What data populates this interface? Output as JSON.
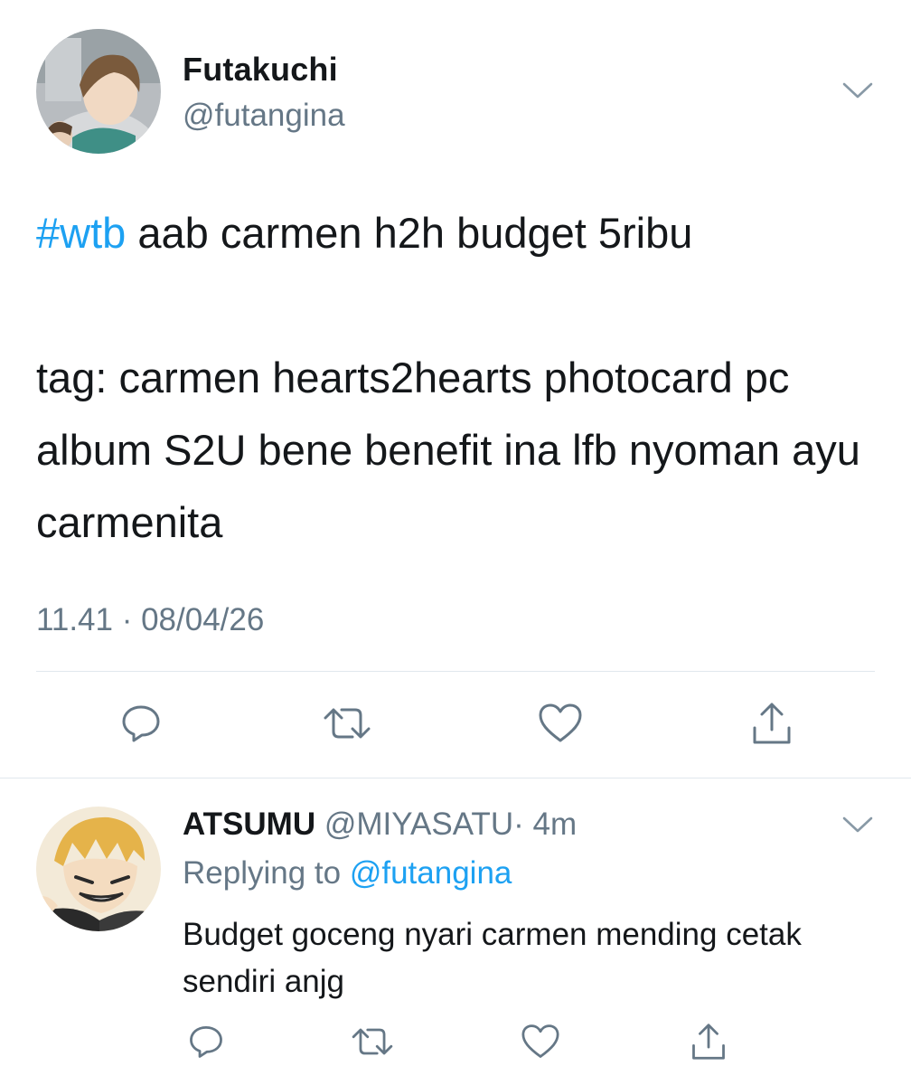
{
  "tweet": {
    "author": {
      "display_name": "Futakuchi",
      "handle": "@futangina"
    },
    "hashtag": "#wtb",
    "text_after_hashtag": " aab carmen h2h budget 5ribu",
    "text_rest": "tag: carmen hearts2hearts photocard pc album S2U bene benefit ina lfb nyoman ayu carmenita",
    "timestamp": "11.41 · 08/04/26",
    "actions": [
      "reply-icon",
      "retweet-icon",
      "like-icon",
      "share-icon"
    ]
  },
  "reply": {
    "author": {
      "display_name": "ATSUMU",
      "handle": "@MIYASATU",
      "age": "· 4m"
    },
    "replying_prefix": "Replying to ",
    "replying_to": "@futangina",
    "text": "Budget goceng nyari carmen mending cetak sendiri anjg",
    "actions": [
      "reply-icon",
      "retweet-icon",
      "like-icon",
      "share-icon"
    ]
  },
  "colors": {
    "link": "#1da1f2",
    "secondary": "#657786",
    "text": "#14171a",
    "divider": "#e1e8ed"
  }
}
